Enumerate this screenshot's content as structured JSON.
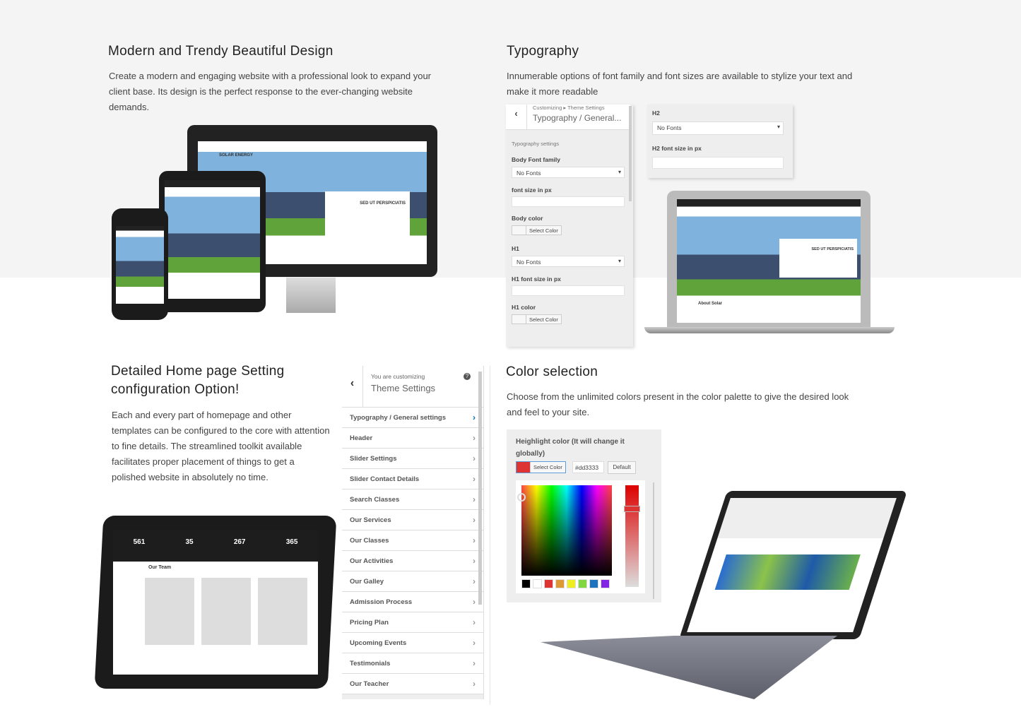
{
  "sections": {
    "design": {
      "title": "Modern and Trendy Beautiful Design",
      "text": "Create a modern and engaging website with a professional look to expand your client base. Its design is the perfect response to the ever-changing website demands."
    },
    "typography": {
      "title": "Typography",
      "text": "Innumerable options of font family and font sizes are available to stylize your text and make it more readable"
    },
    "home": {
      "title": "Detailed Home page Setting configuration Option!",
      "text": "Each and every part of homepage and other templates can be configured to the core with attention to fine details. The streamlined toolkit available facilitates proper placement of things to get a polished website in absolutely no time."
    },
    "color": {
      "title": "Color selection",
      "text": "Choose from the unlimited colors present in the color palette to give the desired look and feel to your site."
    }
  },
  "typo_panel": {
    "breadcrumb": "Customizing ▸ Theme Settings",
    "title": "Typography / General...",
    "group": "Typography settings",
    "body_font_label": "Body Font family",
    "body_font_value": "No Fonts",
    "font_size_label": "font size in px",
    "body_color_label": "Body color",
    "select_color": "Select Color",
    "h1_label": "H1",
    "h1_value": "No Fonts",
    "h1_size_label": "H1 font size in px",
    "h1_color_label": "H1 color"
  },
  "h2_panel": {
    "label": "H2",
    "value": "No Fonts",
    "size_label": "H2 font size in px"
  },
  "customizer": {
    "subtitle": "You are customizing",
    "title": "Theme Settings",
    "items": [
      "Typography / General settings",
      "Header",
      "Slider Settings",
      "Slider Contact Details",
      "Search Classes",
      "Our Services",
      "Our Classes",
      "Our Activities",
      "Our Galley",
      "Admission Process",
      "Pricing Plan",
      "Upcoming Events",
      "Testimonials",
      "Our Teacher"
    ]
  },
  "color_panel": {
    "label": "Heighlight color (It will change it globally)",
    "select_color": "Select Color",
    "hex": "#dd3333",
    "default": "Default",
    "swatches": [
      "#000000",
      "#ffffff",
      "#dd3333",
      "#dd9933",
      "#eeee22",
      "#81d742",
      "#1e73be",
      "#8224e3"
    ]
  },
  "mockup": {
    "brand": "SOLAR ENERGY",
    "slide_title": "SED UT PERSPICIATIS",
    "about": "About Solar",
    "team": "Our Team",
    "stats": [
      "561",
      "35",
      "267",
      "365"
    ]
  },
  "colors": {
    "accent": "#7cc322",
    "highlight": "#dd3333"
  }
}
